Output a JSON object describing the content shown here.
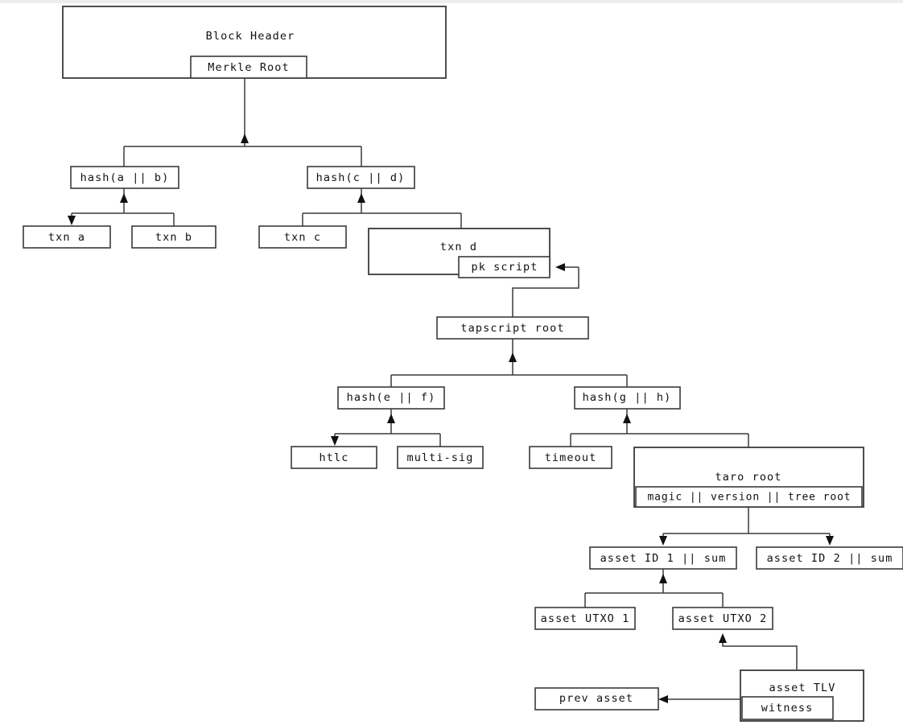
{
  "diagram": {
    "title": "Taro asset tree anchored in a Bitcoin block",
    "type": "merkle-tree-diagram",
    "background_color": "#ffffff",
    "stroke_color": "#3a3a3a",
    "text_color": "#111111",
    "nodes": {
      "block_header": "Block Header",
      "merkle_root": "Merkle Root",
      "hash_ab": "hash(a || b)",
      "hash_cd": "hash(c || d)",
      "txn_a": "txn a",
      "txn_b": "txn b",
      "txn_c": "txn c",
      "txn_d": "txn d",
      "pk_script": "pk script",
      "tapscript_root": "tapscript root",
      "hash_ef": "hash(e || f)",
      "hash_gh": "hash(g || h)",
      "htlc": "htlc",
      "multi_sig": "multi-sig",
      "timeout": "timeout",
      "taro_root": "taro root",
      "magic_version_tree_root": "magic || version || tree root",
      "asset_id_1": "asset ID 1 || sum",
      "asset_id_2": "asset ID 2 || sum",
      "asset_utxo_1": "asset UTXO 1",
      "asset_utxo_2": "asset UTXO 2",
      "asset_tlv": "asset TLV",
      "witness": "witness",
      "prev_asset": "prev asset"
    }
  }
}
